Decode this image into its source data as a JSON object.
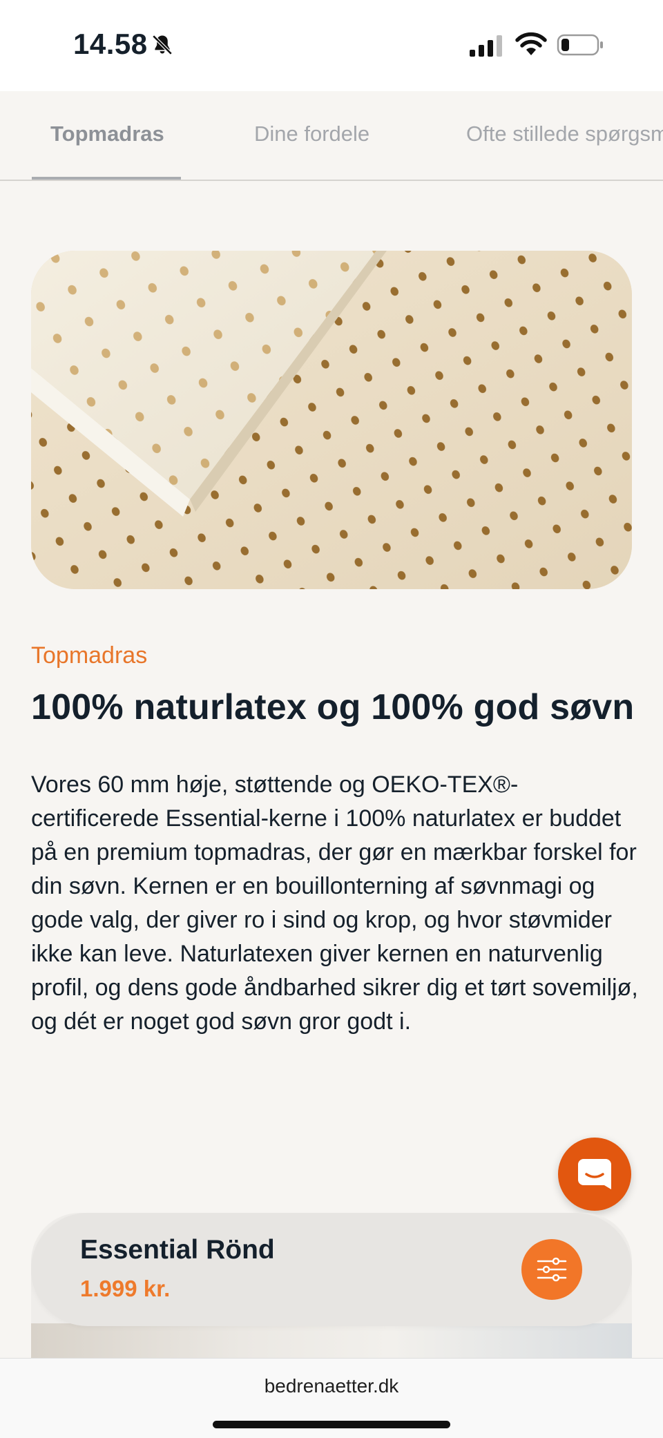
{
  "status_bar": {
    "time": "14.58"
  },
  "tabs": [
    {
      "label": "Topmadras",
      "active": true
    },
    {
      "label": "Dine fordele",
      "active": false
    },
    {
      "label": "Ofte stillede spørgsmål",
      "active": false
    }
  ],
  "section": {
    "eyebrow": "Topmadras",
    "headline": "100% naturlatex og 100% god søvn",
    "body": "Vores 60 mm høje, støttende og OEKO-TEX®-certificerede Essential-kerne i 100% naturlatex er buddet på en premium topmadras, der gør en mærkbar forskel for din søvn. Kernen er en bouillonterning af søvnmagi og gode valg, der giver ro i sind og krop, og hvor støvmider ikke kan leve. Naturlatexen giver kernen en naturvenlig profil, og dens gode åndbarhed sikrer dig et tørt sovemiljø, og dét er noget god søvn gror godt i."
  },
  "product": {
    "name": "Essential Rönd",
    "price": "1.999 kr."
  },
  "browser": {
    "url": "bedrenaetter.dk"
  },
  "colors": {
    "accent": "#e8762a",
    "chat": "#e2570f",
    "text": "#14202c",
    "background": "#f7f5f2"
  },
  "icons": {
    "mute": "bell-slash-icon",
    "signal": "cellular-signal-icon",
    "wifi": "wifi-icon",
    "battery": "battery-icon",
    "chat": "chat-bubble-icon",
    "filter": "sliders-icon"
  }
}
